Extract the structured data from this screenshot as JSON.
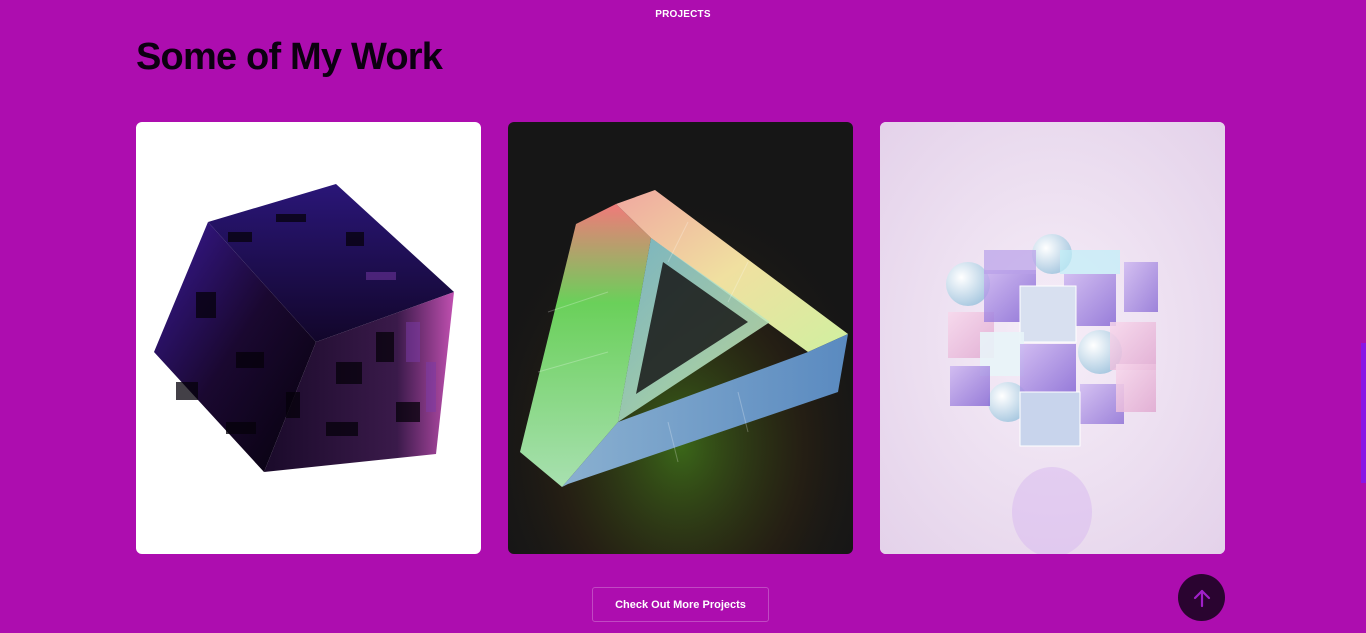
{
  "section": {
    "label": "PROJECTS"
  },
  "heading": {
    "title": "Some of My Work"
  },
  "projects": [
    {
      "image": "dark-purple-fractal-cube-render"
    },
    {
      "image": "impossible-penrose-triangle-render"
    },
    {
      "image": "glass-cubes-and-spheres-render"
    }
  ],
  "actions": {
    "more_label": "Check Out More Projects",
    "scroll_top_icon": "arrow-up-icon"
  },
  "colors": {
    "background": "#ad0daf",
    "title": "#0c0010",
    "scroll_button": "#2a0430",
    "scroll_arrow": "#a020c8"
  }
}
